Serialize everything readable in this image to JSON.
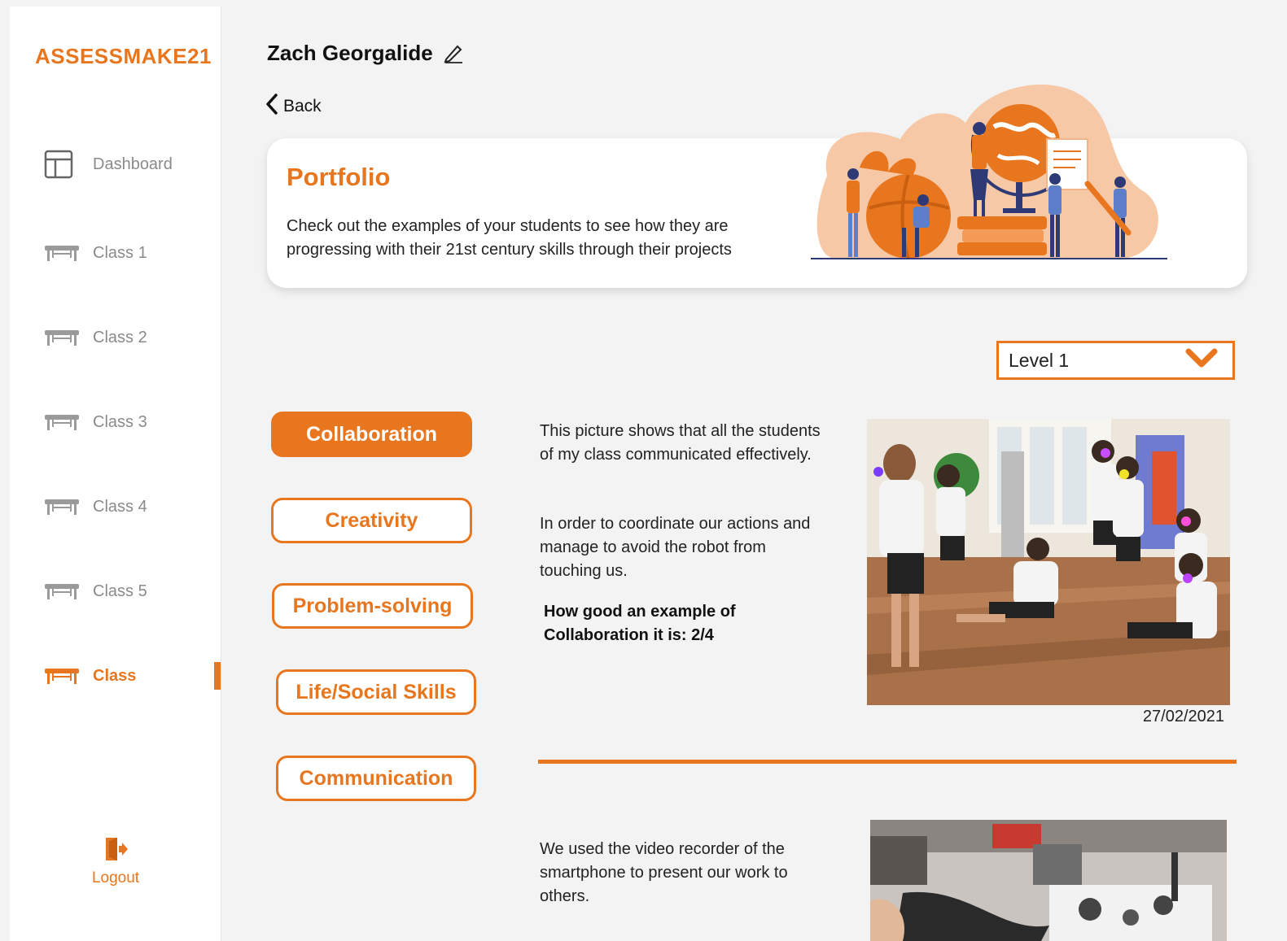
{
  "app": {
    "brand": "ASSESSMAKE21",
    "accent_color": "#e8761e"
  },
  "sidebar": {
    "items": [
      {
        "label": "Dashboard",
        "icon": "dashboard-icon",
        "active": false
      },
      {
        "label": "Class 1",
        "icon": "desk-icon",
        "active": false
      },
      {
        "label": "Class 2",
        "icon": "desk-icon",
        "active": false
      },
      {
        "label": "Class 3",
        "icon": "desk-icon",
        "active": false
      },
      {
        "label": "Class 4",
        "icon": "desk-icon",
        "active": false
      },
      {
        "label": "Class 5",
        "icon": "desk-icon",
        "active": false
      },
      {
        "label": "Class",
        "icon": "desk-icon",
        "active": true
      }
    ],
    "logout_label": "Logout",
    "logout_icon": "logout-icon"
  },
  "header": {
    "user_name": "Zach Georgalide",
    "edit_icon": "pencil-icon",
    "back_label": "Back"
  },
  "portfolio": {
    "title": "Portfolio",
    "description": "Check out the examples of your students to see how they are progressing with their 21st century skills through their projects"
  },
  "filter": {
    "level_value": "Level 1",
    "icon": "chevron-down-icon"
  },
  "skills": [
    {
      "label": "Collaboration",
      "selected": true
    },
    {
      "label": "Creativity",
      "selected": false
    },
    {
      "label": "Problem-solving",
      "selected": false
    },
    {
      "label": "Life/Social Skills",
      "selected": false
    },
    {
      "label": "Communication",
      "selected": false
    }
  ],
  "entries": [
    {
      "paragraph1": "This picture shows that all the students of my class communicated effectively.",
      "paragraph2": "In order to coordinate our actions and manage to avoid the robot from touching us.",
      "rating_line1": "How good an example of",
      "rating_line2": "Collaboration it is: 2/4",
      "date": "27/02/2021"
    },
    {
      "paragraph1": "We used the video recorder of the smartphone to present our work to others."
    }
  ]
}
